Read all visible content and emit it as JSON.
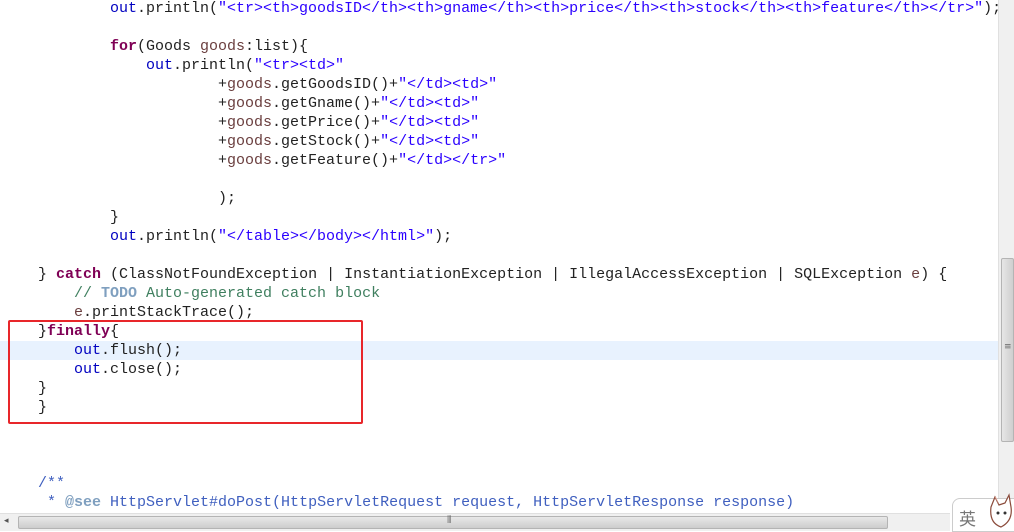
{
  "editor": {
    "current_line_index": 15,
    "lines": [
      {
        "indent": 12,
        "row": 0,
        "tokens": [
          [
            "fld",
            "out"
          ],
          [
            "plain",
            ".println("
          ],
          [
            "str",
            "\"<tr><th>goodsID</th><th>gname</th><th>price</th><th>stock</th><th>feature</th></tr>\""
          ],
          [
            "plain",
            ");"
          ]
        ]
      },
      {
        "indent": 12,
        "row": 2,
        "tokens": [
          [
            "kw",
            "for"
          ],
          [
            "plain",
            "(Goods "
          ],
          [
            "var",
            "goods"
          ],
          [
            "plain",
            ":list){"
          ]
        ]
      },
      {
        "indent": 16,
        "row": 3,
        "tokens": [
          [
            "fld",
            "out"
          ],
          [
            "plain",
            ".println("
          ],
          [
            "str",
            "\"<tr><td>\""
          ]
        ]
      },
      {
        "indent": 24,
        "row": 4,
        "tokens": [
          [
            "plain",
            "+"
          ],
          [
            "var",
            "goods"
          ],
          [
            "plain",
            ".getGoodsID()+"
          ],
          [
            "str",
            "\"</td><td>\""
          ]
        ]
      },
      {
        "indent": 24,
        "row": 5,
        "tokens": [
          [
            "plain",
            "+"
          ],
          [
            "var",
            "goods"
          ],
          [
            "plain",
            ".getGname()+"
          ],
          [
            "str",
            "\"</td><td>\""
          ]
        ]
      },
      {
        "indent": 24,
        "row": 6,
        "tokens": [
          [
            "plain",
            "+"
          ],
          [
            "var",
            "goods"
          ],
          [
            "plain",
            ".getPrice()+"
          ],
          [
            "str",
            "\"</td><td>\""
          ]
        ]
      },
      {
        "indent": 24,
        "row": 7,
        "tokens": [
          [
            "plain",
            "+"
          ],
          [
            "var",
            "goods"
          ],
          [
            "plain",
            ".getStock()+"
          ],
          [
            "str",
            "\"</td><td>\""
          ]
        ]
      },
      {
        "indent": 24,
        "row": 8,
        "tokens": [
          [
            "plain",
            "+"
          ],
          [
            "var",
            "goods"
          ],
          [
            "plain",
            ".getFeature()+"
          ],
          [
            "str",
            "\"</td></tr>\""
          ]
        ]
      },
      {
        "indent": 24,
        "row": 10,
        "tokens": [
          [
            "plain",
            ");"
          ]
        ]
      },
      {
        "indent": 12,
        "row": 11,
        "tokens": [
          [
            "plain",
            "}"
          ]
        ]
      },
      {
        "indent": 12,
        "row": 12,
        "tokens": [
          [
            "fld",
            "out"
          ],
          [
            "plain",
            ".println("
          ],
          [
            "str",
            "\"</table></body></html>\""
          ],
          [
            "plain",
            ");"
          ]
        ]
      },
      {
        "indent": 4,
        "row": 14,
        "tokens": [
          [
            "plain",
            "} "
          ],
          [
            "kw",
            "catch"
          ],
          [
            "plain",
            " (ClassNotFoundException | InstantiationException | IllegalAccessException | SQLException "
          ],
          [
            "var",
            "e"
          ],
          [
            "plain",
            ") {"
          ]
        ]
      },
      {
        "indent": 8,
        "row": 15,
        "tokens": [
          [
            "cmt",
            "// "
          ],
          [
            "todo",
            "TODO"
          ],
          [
            "cmt",
            " Auto-generated catch block"
          ]
        ]
      },
      {
        "indent": 8,
        "row": 16,
        "tokens": [
          [
            "var",
            "e"
          ],
          [
            "plain",
            ".printStackTrace();"
          ]
        ]
      },
      {
        "indent": 4,
        "row": 17,
        "tokens": [
          [
            "plain",
            "}"
          ],
          [
            "kw",
            "finally"
          ],
          [
            "plain",
            "{"
          ]
        ]
      },
      {
        "indent": 8,
        "row": 18,
        "tokens": [
          [
            "fld",
            "out"
          ],
          [
            "plain",
            ".flush();"
          ]
        ]
      },
      {
        "indent": 8,
        "row": 19,
        "tokens": [
          [
            "fld",
            "out"
          ],
          [
            "plain",
            ".close();"
          ]
        ]
      },
      {
        "indent": 4,
        "row": 20,
        "tokens": [
          [
            "plain",
            "}"
          ]
        ]
      },
      {
        "indent": 4,
        "row": 21,
        "tokens": [
          [
            "plain",
            "}"
          ]
        ]
      },
      {
        "indent": 4,
        "row": 25,
        "tokens": [
          [
            "doc",
            "/**"
          ]
        ]
      },
      {
        "indent": 4,
        "row": 26,
        "tokens": [
          [
            "doc",
            " * "
          ],
          [
            "tag",
            "@see"
          ],
          [
            "doc",
            " HttpServlet#doPost(HttpServletRequest request, HttpServletResponse response)"
          ]
        ]
      }
    ]
  },
  "highlight_box_color": "#e8262a",
  "ime": {
    "label": "英",
    "icon": "ime-mascot-icon"
  }
}
